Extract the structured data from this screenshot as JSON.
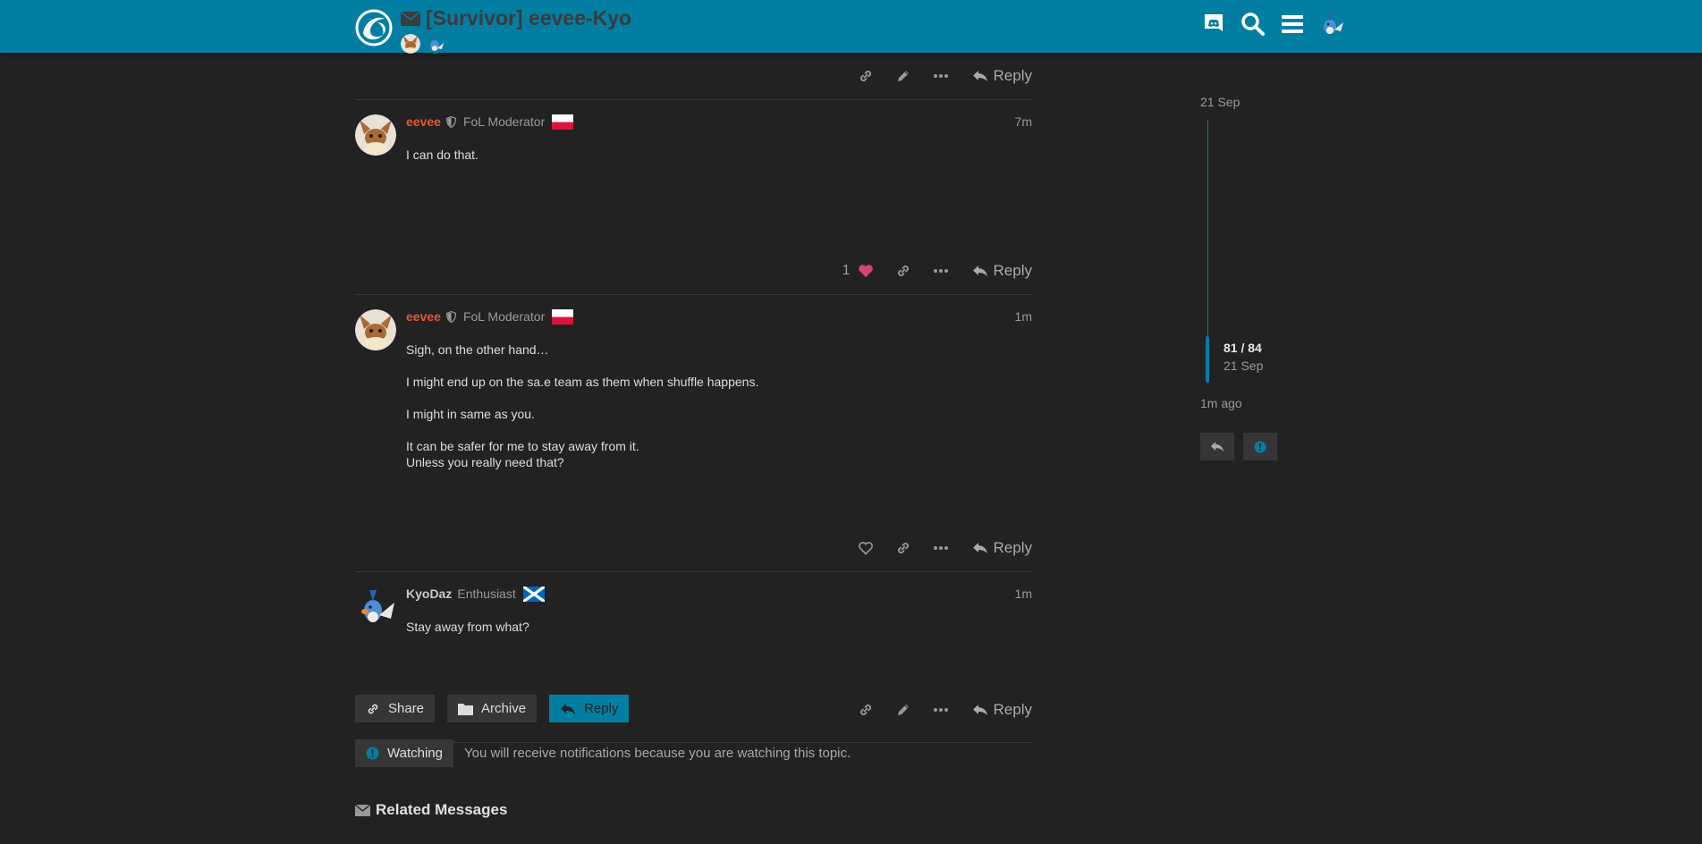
{
  "header": {
    "title": "[Survivor] eevee-Kyo",
    "icons": [
      "logo-icon",
      "envelope-icon",
      "discord-icon",
      "search-icon",
      "hamburger-menu-icon",
      "user-avatar"
    ]
  },
  "posts": [
    {
      "username": "eevee",
      "user_title": "FoL Moderator",
      "flag": "poland",
      "time": "7m",
      "body": [
        "I can do that."
      ],
      "likes": "1"
    },
    {
      "username": "eevee",
      "user_title": "FoL Moderator",
      "flag": "poland",
      "time": "1m",
      "body": [
        "Sigh, on the other hand…",
        "I might end up on the sa.e team as them when shuffle happens.",
        "I might in same as you.",
        "It can be safer for me to stay away from it.",
        "Unless you really need that?"
      ]
    },
    {
      "username": "KyoDaz",
      "user_title": "Enthusiast",
      "flag": "scotland",
      "time": "1m",
      "body": [
        "Stay away from what?"
      ]
    }
  ],
  "actions": {
    "reply_label": "Reply"
  },
  "footer": {
    "share_label": "Share",
    "archive_label": "Archive",
    "reply_label": "Reply",
    "watching_label": "Watching",
    "notification_text": "You will receive notifications because you are watching this topic.",
    "related_label": "Related Messages"
  },
  "timeline": {
    "start_date": "21 Sep",
    "position": "81 / 84",
    "position_date": "21 Sep",
    "end_label": "1m ago"
  },
  "colors": {
    "header": "#037ea3",
    "background": "#222222",
    "moderator_name": "#e45735",
    "like_heart": "#d6466f"
  }
}
